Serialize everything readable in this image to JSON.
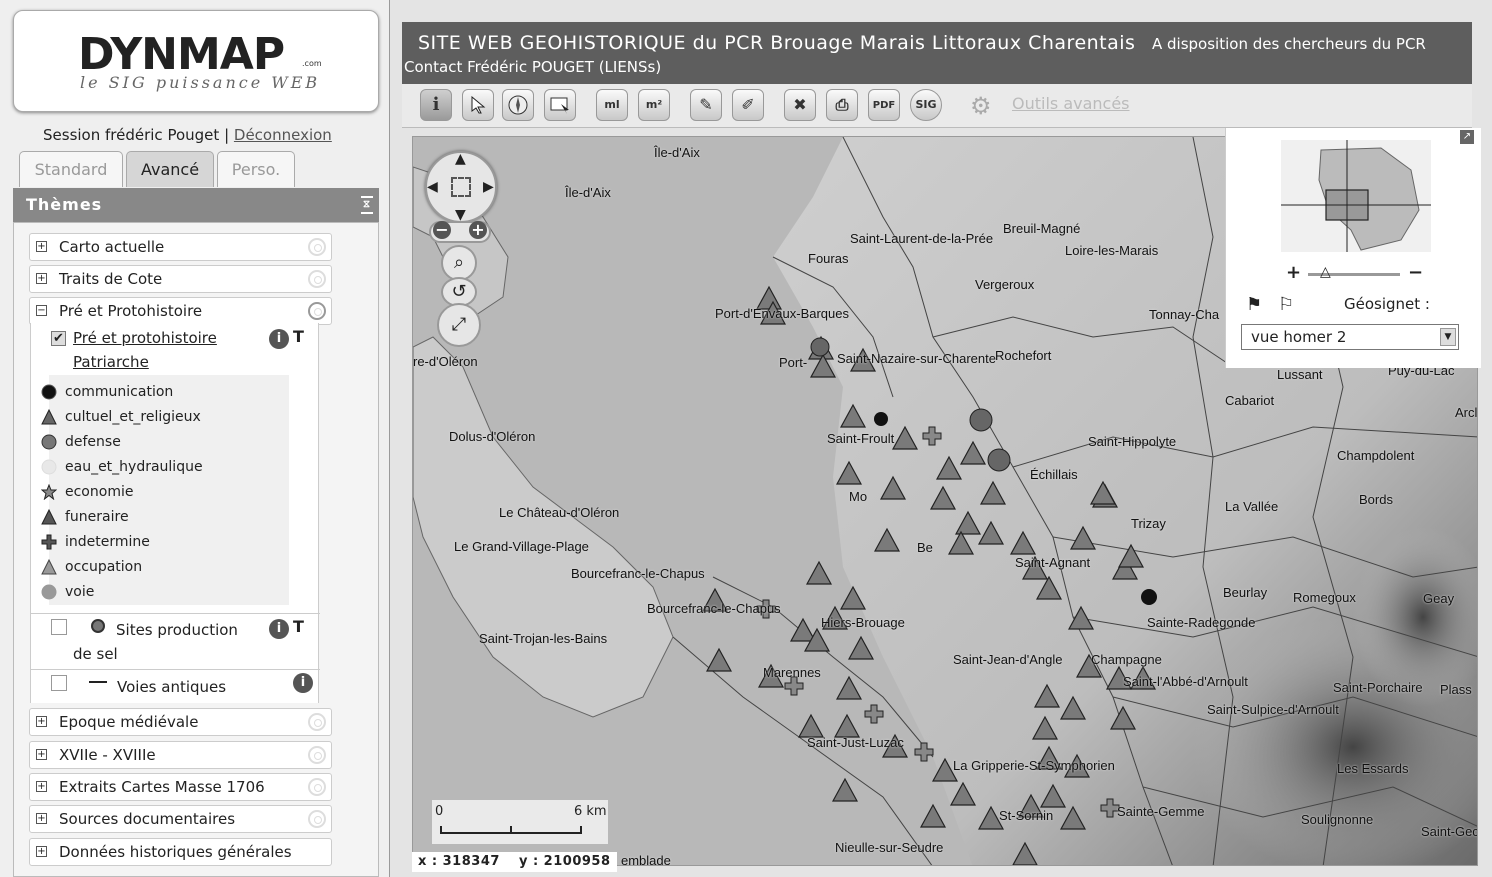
{
  "app": {
    "logo": "DYNMAP",
    "logo_suffix": ".com",
    "logo_tagline": "le SIG puissance WEB"
  },
  "session": {
    "label": "Session frédéric Pouget",
    "separator": "|",
    "logout": "Déconnexion"
  },
  "left_tabs": [
    "Standard",
    "Avancé",
    "Perso."
  ],
  "active_tab": "Avancé",
  "themes_title": "Thèmes",
  "themes": [
    {
      "label": "Carto actuelle",
      "expand": "+"
    },
    {
      "label": "Traits de Cote",
      "expand": "+"
    },
    {
      "label": "Pré et Protohistoire",
      "expand": "−"
    },
    {
      "label": "Epoque médiévale",
      "expand": "+"
    },
    {
      "label": "XVIIe - XVIIIe",
      "expand": "+"
    },
    {
      "label": "Extraits Cartes Masse 1706",
      "expand": "+"
    },
    {
      "label": "Sources documentaires",
      "expand": "+"
    },
    {
      "label": "Données historiques générales",
      "expand": "+"
    }
  ],
  "proto": {
    "layer_line1": "Pré et protohistoire",
    "layer_line2": "Patriarche",
    "legend": [
      {
        "label": "communication",
        "symbol": "circle-dark"
      },
      {
        "label": "cultuel_et_religieux",
        "symbol": "triangle"
      },
      {
        "label": "defense",
        "symbol": "circle-gray"
      },
      {
        "label": "eau_et_hydraulique",
        "symbol": "circle-light"
      },
      {
        "label": "economie",
        "symbol": "star"
      },
      {
        "label": "funeraire",
        "symbol": "triangle"
      },
      {
        "label": "indetermine",
        "symbol": "cross"
      },
      {
        "label": "occupation",
        "symbol": "triangle-light"
      },
      {
        "label": "voie",
        "symbol": "circle-gray"
      }
    ],
    "sel_line1": "Sites production",
    "sel_line2": "de sel",
    "voies": "Voies antiques"
  },
  "header": {
    "title": "SITE WEB GEOHISTORIQUE du PCR Brouage Marais Littoraux Charentais",
    "subtitle": "A disposition des chercheurs du PCR",
    "contact": "Contact Frédéric POUGET (LIENSs)"
  },
  "toolbar": {
    "ml": "ml",
    "m2": "m²",
    "pdf": "PDF",
    "sig": "SIG",
    "outils": "Outils avancés"
  },
  "overview": {
    "geosignet_label": "Géosignet :",
    "geosignet_value": "vue homer 2"
  },
  "map": {
    "places": [
      {
        "name": "Île-d'Aix"
      },
      {
        "name": "Île-d'Aix"
      },
      {
        "name": "Saint-Laurent-de-la-Prée"
      },
      {
        "name": "Breuil-Magné"
      },
      {
        "name": "Loire-les-Marais"
      },
      {
        "name": "Fouras"
      },
      {
        "name": "Vergeroux"
      },
      {
        "name": "Port-d'Envaux-Barques"
      },
      {
        "name": "Tonnay-Cha"
      },
      {
        "name": "Port-"
      },
      {
        "name": "Saint-Nazaire-sur-Charente"
      },
      {
        "name": "Rochefort"
      },
      {
        "name": "re-d'Oléron"
      },
      {
        "name": "Lussant"
      },
      {
        "name": "Puy-du-Lac"
      },
      {
        "name": "Cabariot"
      },
      {
        "name": "Arcl"
      },
      {
        "name": "Dolus-d'Oléron"
      },
      {
        "name": "Saint-Froult"
      },
      {
        "name": "Saint-Hippolyte"
      },
      {
        "name": "Champdolent"
      },
      {
        "name": "Échillais"
      },
      {
        "name": "Bords"
      },
      {
        "name": "Mo"
      },
      {
        "name": "La Vallée"
      },
      {
        "name": "Le Château-d'Oléron"
      },
      {
        "name": "Trizay"
      },
      {
        "name": "Le Grand-Village-Plage"
      },
      {
        "name": "Be"
      },
      {
        "name": "Saint-Agnant"
      },
      {
        "name": "Bourcefranc-le-Chapus"
      },
      {
        "name": "Beurlay"
      },
      {
        "name": "Romegoux"
      },
      {
        "name": "Geay"
      },
      {
        "name": "Bourcefranc-le-Chapus"
      },
      {
        "name": "Hiers-Brouage"
      },
      {
        "name": "Saint-Trojan-les-Bains"
      },
      {
        "name": "Sainte-Radegonde"
      },
      {
        "name": "Saint-Jean-d'Angle"
      },
      {
        "name": "Champagne"
      },
      {
        "name": "Marennes"
      },
      {
        "name": "Saint-l'Abbé-d'Arnoult"
      },
      {
        "name": "Saint-Porchaire"
      },
      {
        "name": "Plass"
      },
      {
        "name": "Saint-Sulpice-d'Arnoult"
      },
      {
        "name": "Saint-Just-Luzac"
      },
      {
        "name": "La Gripperie-St-Symphorien"
      },
      {
        "name": "Les Essards"
      },
      {
        "name": "Sainte-Gemme"
      },
      {
        "name": "Soulignonne"
      },
      {
        "name": "Saint-Gec"
      },
      {
        "name": "Nieulle-sur-Seudre"
      },
      {
        "name": "St-Sornin"
      },
      {
        "name": "emblade"
      }
    ],
    "scale_start": "0",
    "scale_end": "6 km",
    "coord_x": "x : 318347",
    "coord_y": "y : 2100958"
  }
}
